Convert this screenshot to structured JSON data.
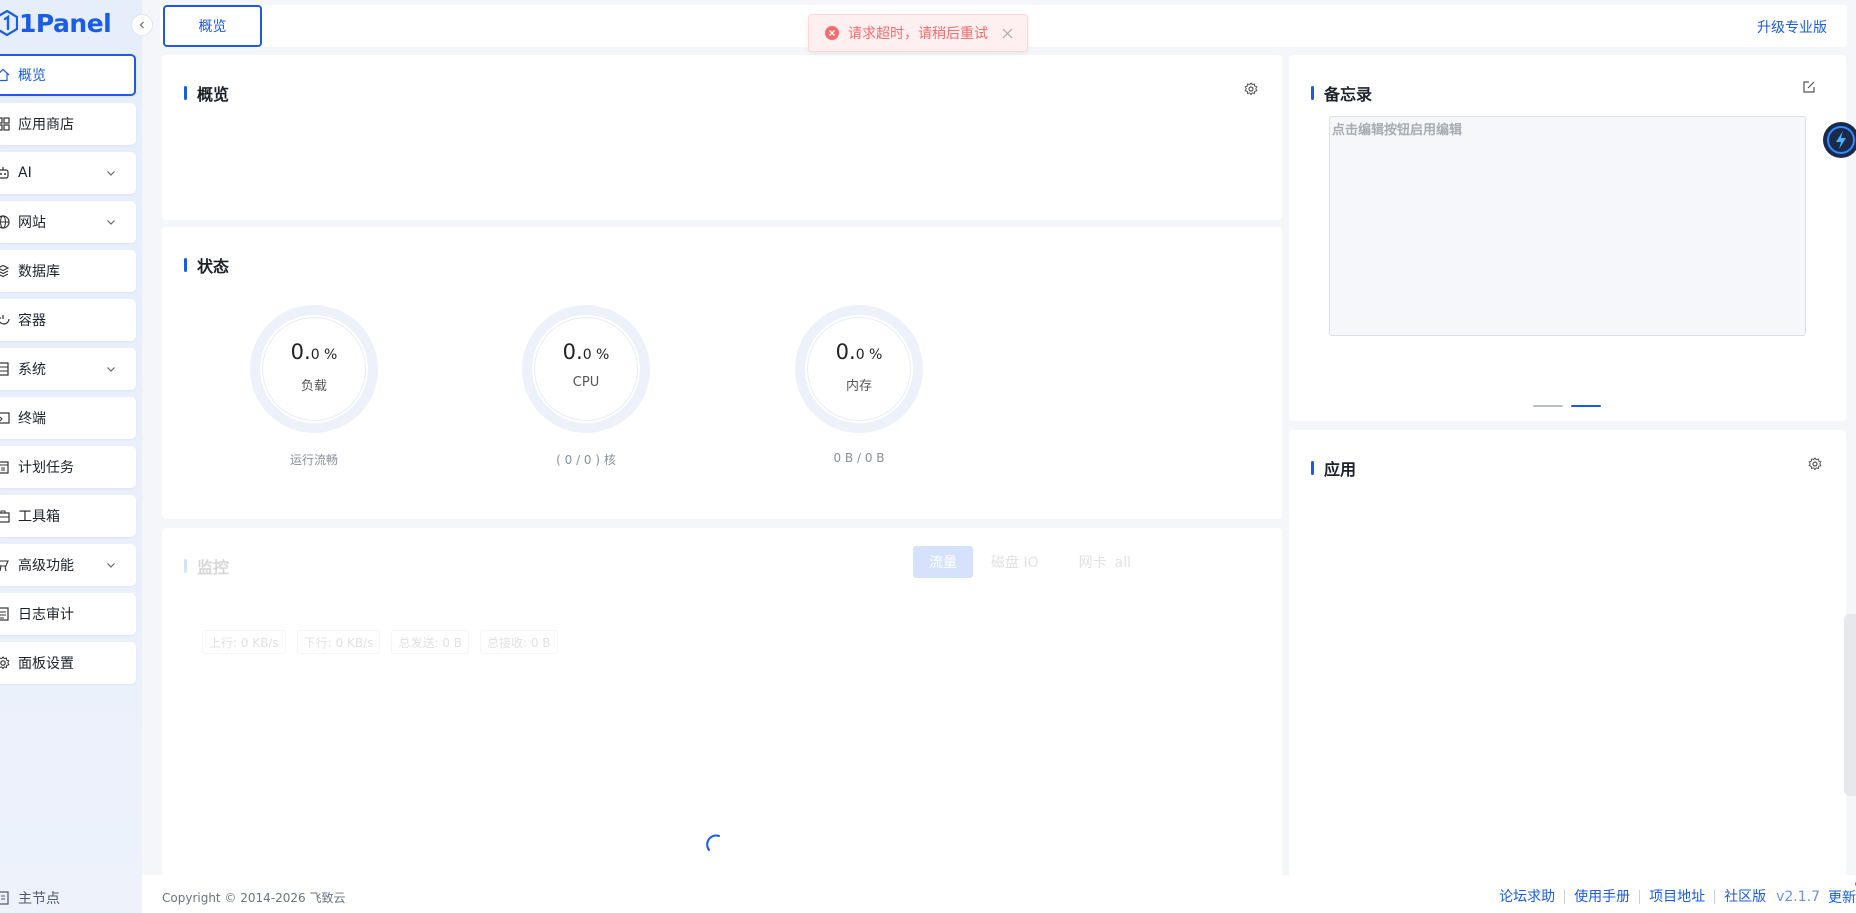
{
  "brand": {
    "name": "1Panel"
  },
  "sidebar": {
    "items": [
      {
        "label": "概览",
        "icon": "home-icon",
        "active": true
      },
      {
        "label": "应用商店",
        "icon": "app-grid-icon"
      },
      {
        "label": "AI",
        "icon": "robot-icon",
        "expandable": true
      },
      {
        "label": "网站",
        "icon": "globe-icon",
        "expandable": true
      },
      {
        "label": "数据库",
        "icon": "database-icon"
      },
      {
        "label": "容器",
        "icon": "container-icon"
      },
      {
        "label": "系统",
        "icon": "server-icon",
        "expandable": true
      },
      {
        "label": "终端",
        "icon": "terminal-icon"
      },
      {
        "label": "计划任务",
        "icon": "calendar-icon"
      },
      {
        "label": "工具箱",
        "icon": "toolbox-icon"
      },
      {
        "label": "高级功能",
        "icon": "advanced-icon",
        "expandable": true
      },
      {
        "label": "日志审计",
        "icon": "log-icon"
      },
      {
        "label": "面板设置",
        "icon": "settings-icon"
      }
    ],
    "master_node": "主节点"
  },
  "header": {
    "tab_label": "概览",
    "upgrade_label": "升级专业版"
  },
  "toast": {
    "message": "请求超时，请稍后重试",
    "type": "error"
  },
  "overview": {
    "title": "概览"
  },
  "status": {
    "title": "状态",
    "gauges": [
      {
        "int": "0.",
        "dec": "0 %",
        "label": "负载",
        "sub": "运行流畅",
        "percent": 0
      },
      {
        "int": "0.",
        "dec": "0 %",
        "label": "CPU",
        "sub": "( 0 / 0 ) 核",
        "percent": 0
      },
      {
        "int": "0.",
        "dec": "0 %",
        "label": "内存",
        "sub": "0 B / 0 B",
        "percent": 0
      }
    ]
  },
  "monitor": {
    "title": "监控",
    "tabs": [
      "流量",
      "磁盘 IO"
    ],
    "nic_label": "网卡",
    "nic_value": "all",
    "tags": [
      "上行: 0 KB/s",
      "下行: 0 KB/s",
      "总发送: 0 B",
      "总接收: 0 B"
    ]
  },
  "memo": {
    "title": "备忘录",
    "placeholder": "点击编辑按钮启用编辑"
  },
  "apps": {
    "title": "应用"
  },
  "footer": {
    "copyright": "Copyright © 2014-2026 飞致云",
    "links": [
      "论坛求助",
      "使用手册",
      "项目地址",
      "社区版"
    ],
    "version": "v2.1.7",
    "update": "更新"
  },
  "colors": {
    "accent": "#1a5ce5",
    "error": "#f56c6c",
    "sidebar_bg": "#e6eefc"
  }
}
